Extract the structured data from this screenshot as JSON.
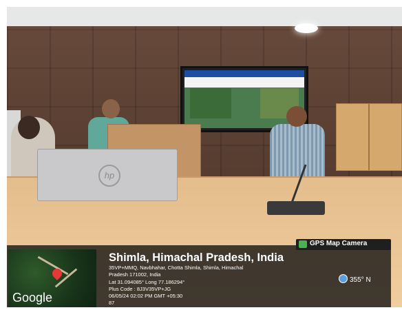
{
  "camera_badge": "GPS Map Camera",
  "location": {
    "title": "Shimla, Himachal Pradesh, India",
    "address_line_1": "35VP+MMQ, Navbhahar, Chotta Shimla, Shimla, Himachal",
    "address_line_2": "Pradesh 171002, India",
    "coords": "Lat 31.094085° Long 77.186294°",
    "plus_code": "Plus Code : 8J3V35VP+JG",
    "datetime": "06/05/24 02:02 PM GMT +05:30",
    "extra": "87"
  },
  "compass": "355° N",
  "map": {
    "attribution": "Google"
  },
  "laptop_logo": "hp"
}
